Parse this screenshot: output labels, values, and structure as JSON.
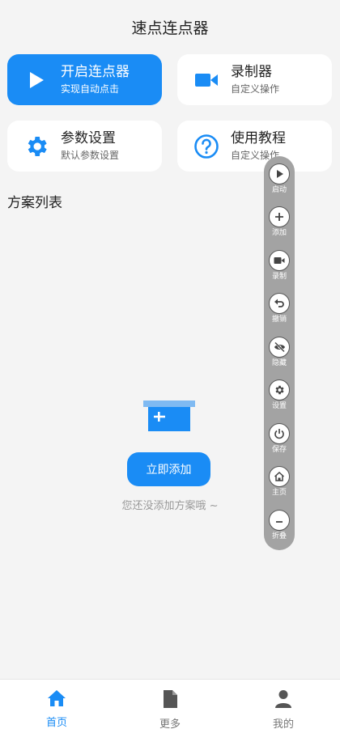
{
  "app_title": "速点连点器",
  "cards": [
    {
      "title": "开启连点器",
      "subtitle": "实现自动点击",
      "icon": "play-icon"
    },
    {
      "title": "录制器",
      "subtitle": "自定义操作",
      "icon": "video-camera-icon"
    },
    {
      "title": "参数设置",
      "subtitle": "默认参数设置",
      "icon": "gear-icon"
    },
    {
      "title": "使用教程",
      "subtitle": "自定义操作",
      "icon": "question-circle-icon"
    }
  ],
  "section_title": "方案列表",
  "empty": {
    "button_label": "立即添加",
    "message": "您还没添加方案哦 ~"
  },
  "float_bar": [
    {
      "label": "启动",
      "icon": "play-icon"
    },
    {
      "label": "添加",
      "icon": "plus-icon"
    },
    {
      "label": "录制",
      "icon": "video-camera-icon"
    },
    {
      "label": "撤销",
      "icon": "undo-icon"
    },
    {
      "label": "隐藏",
      "icon": "eye-off-icon"
    },
    {
      "label": "设置",
      "icon": "gear-icon"
    },
    {
      "label": "保存",
      "icon": "power-icon"
    },
    {
      "label": "主页",
      "icon": "home-icon"
    },
    {
      "label": "折叠",
      "icon": "minus-icon"
    }
  ],
  "tabs": [
    {
      "label": "首页",
      "icon": "home-icon",
      "active": true
    },
    {
      "label": "更多",
      "icon": "document-icon",
      "active": false
    },
    {
      "label": "我的",
      "icon": "user-icon",
      "active": false
    }
  ],
  "colors": {
    "accent": "#1a8cf5",
    "float_bar": "#a3a3a3",
    "background": "#f4f4f4"
  }
}
